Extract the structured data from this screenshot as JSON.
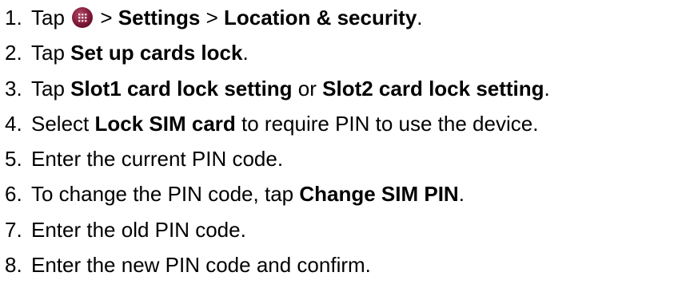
{
  "steps": [
    {
      "number": "1.",
      "parts": [
        {
          "text": "Tap ",
          "bold": false
        },
        {
          "icon": "apps-grid-icon"
        },
        {
          "text": " > ",
          "bold": false
        },
        {
          "text": "Settings",
          "bold": true
        },
        {
          "text": " > ",
          "bold": false
        },
        {
          "text": "Location & security",
          "bold": true
        },
        {
          "text": ".",
          "bold": false
        }
      ]
    },
    {
      "number": "2.",
      "parts": [
        {
          "text": "Tap ",
          "bold": false
        },
        {
          "text": "Set up cards lock",
          "bold": true
        },
        {
          "text": ".",
          "bold": false
        }
      ]
    },
    {
      "number": "3.",
      "parts": [
        {
          "text": "Tap ",
          "bold": false
        },
        {
          "text": "Slot1 card lock setting",
          "bold": true
        },
        {
          "text": " or ",
          "bold": false
        },
        {
          "text": "Slot2 card lock setting",
          "bold": true
        },
        {
          "text": ".",
          "bold": false
        }
      ]
    },
    {
      "number": "4.",
      "parts": [
        {
          "text": "Select ",
          "bold": false
        },
        {
          "text": "Lock SIM card",
          "bold": true
        },
        {
          "text": " to require PIN to use the device.",
          "bold": false
        }
      ]
    },
    {
      "number": "5.",
      "parts": [
        {
          "text": "Enter the current PIN code.",
          "bold": false
        }
      ]
    },
    {
      "number": "6.",
      "parts": [
        {
          "text": "To change the PIN code, tap ",
          "bold": false
        },
        {
          "text": "Change SIM PIN",
          "bold": true
        },
        {
          "text": ".",
          "bold": false
        }
      ]
    },
    {
      "number": "7.",
      "parts": [
        {
          "text": "Enter the old PIN code.",
          "bold": false
        }
      ]
    },
    {
      "number": "8.",
      "parts": [
        {
          "text": "Enter the new PIN code and confirm.",
          "bold": false
        }
      ]
    }
  ]
}
